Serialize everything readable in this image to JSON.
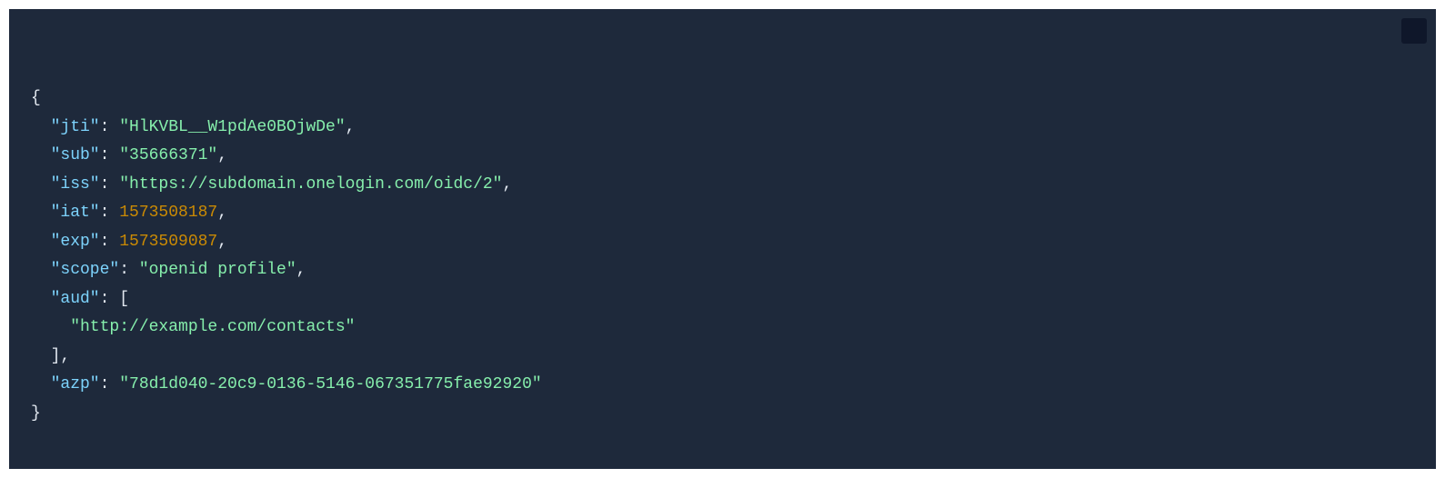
{
  "code": {
    "brace_open": "{",
    "brace_close": "}",
    "bracket_open": "[",
    "bracket_close": "]",
    "comma": ",",
    "colon_sp": ": ",
    "jti_key": "\"jti\"",
    "jti_val": "\"HlKVBL__W1pdAe0BOjwDe\"",
    "sub_key": "\"sub\"",
    "sub_val": "\"35666371\"",
    "iss_key": "\"iss\"",
    "iss_val": "\"https://subdomain.onelogin.com/oidc/2\"",
    "iat_key": "\"iat\"",
    "iat_val": "1573508187",
    "exp_key": "\"exp\"",
    "exp_val": "1573509087",
    "scope_key": "\"scope\"",
    "scope_val": "\"openid profile\"",
    "aud_key": "\"aud\"",
    "aud_val0": "\"http://example.com/contacts\"",
    "azp_key": "\"azp\"",
    "azp_val": "\"78d1d040-20c9-0136-5146-067351775fae92920\""
  }
}
